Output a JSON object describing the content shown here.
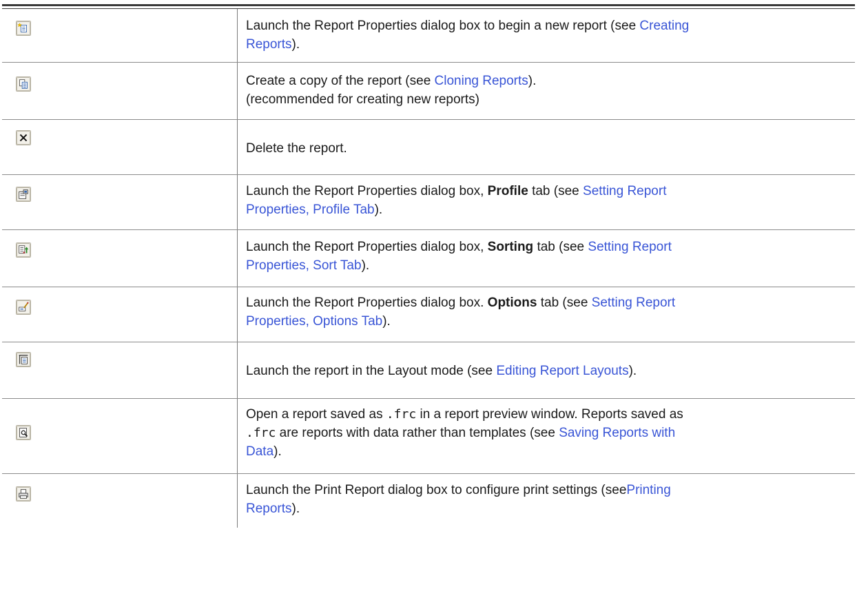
{
  "rows": [
    {
      "icon": "new-report-icon",
      "text": [
        "Launch the Report Properties dialog box to begin a new report (see ",
        "Creating",
        "Reports",
        ")."
      ]
    },
    {
      "icon": "clone-report-icon",
      "text": [
        "Create a copy of the report (see ",
        "Cloning Reports",
        ").",
        "(recommended for creating new reports)"
      ]
    },
    {
      "icon": "delete-report-icon",
      "text": [
        "Delete the report."
      ]
    },
    {
      "icon": "properties-profile-icon",
      "text": [
        "Launch the Report Properties dialog box, ",
        "Profile",
        " tab (see ",
        "Setting Report",
        "Properties, Profile Tab",
        ")."
      ]
    },
    {
      "icon": "sorting-icon",
      "text": [
        "Launch the Report Properties dialog box, ",
        "Sorting",
        " tab (see ",
        "Setting Report",
        "Properties, Sort Tab",
        ")."
      ]
    },
    {
      "icon": "options-icon",
      "text": [
        "Launch the Report Properties dialog box. ",
        "Options",
        " tab (see ",
        "Setting Report",
        "Properties, Options Tab",
        ")."
      ]
    },
    {
      "icon": "layout-mode-icon",
      "text": [
        "Launch the report in the Layout mode (see ",
        "Editing Report Layouts",
        ")."
      ]
    },
    {
      "icon": "preview-icon",
      "text": [
        "Open a report saved as ",
        ".frc",
        " in a report preview window. Reports saved as",
        ".frc",
        " are reports with data rather than templates (see ",
        "Saving Reports with",
        "Data",
        ")."
      ]
    },
    {
      "icon": "print-icon",
      "text": [
        "Launch the Print Report dialog box to configure print settings (see",
        "Printing",
        "Reports",
        ")."
      ]
    }
  ],
  "colors": {
    "link": "#3955d6",
    "text": "#1a1a1a",
    "rule": "#3a3a3a"
  }
}
